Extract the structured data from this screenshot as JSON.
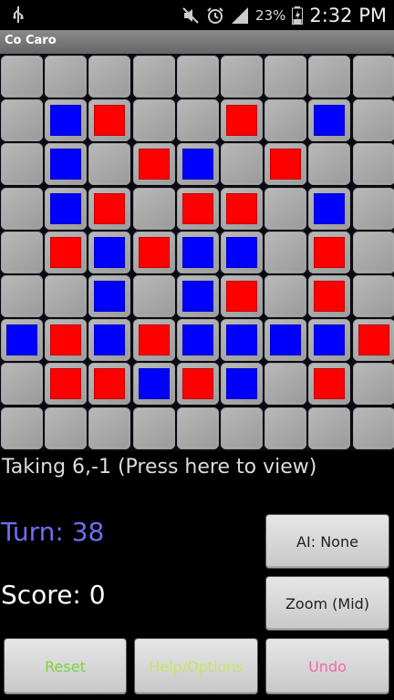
{
  "status_bar": {
    "battery_percent": "23%",
    "time": "2:32 PM",
    "icons": [
      "usb-icon",
      "mute-icon",
      "alarm-icon",
      "signal-icon",
      "battery-icon"
    ]
  },
  "app": {
    "title": "Co Caro"
  },
  "board": {
    "rows": 9,
    "cols": 9,
    "cells": [
      [
        "",
        "",
        "",
        "",
        "",
        "",
        "",
        "",
        ""
      ],
      [
        "",
        "blue",
        "red",
        "",
        "",
        "red",
        "",
        "blue",
        ""
      ],
      [
        "",
        "blue",
        "",
        "red",
        "blue",
        "",
        "red",
        "",
        ""
      ],
      [
        "",
        "blue",
        "red",
        "",
        "red",
        "red",
        "",
        "blue",
        ""
      ],
      [
        "",
        "red",
        "blue",
        "red",
        "blue",
        "blue",
        "",
        "red",
        ""
      ],
      [
        "",
        "",
        "blue",
        "",
        "blue",
        "red",
        "",
        "red",
        ""
      ],
      [
        "blue",
        "red",
        "blue",
        "red",
        "blue",
        "blue",
        "blue",
        "blue",
        "red"
      ],
      [
        "",
        "red",
        "red",
        "blue",
        "red",
        "blue",
        "",
        "red",
        ""
      ],
      [
        "",
        "",
        "",
        "",
        "",
        "",
        "",
        "",
        ""
      ]
    ],
    "colors": {
      "red": "#ff0000",
      "blue": "#0000ff",
      "empty": "#aaaaaa"
    }
  },
  "message": "Taking 6,-1 (Press here to view)",
  "turn_label": "Turn: 38",
  "score_label": "Score: 0",
  "buttons": {
    "ai": "AI: None",
    "zoom": "Zoom (Mid)",
    "reset": "Reset",
    "help": "Help/Options",
    "undo": "Undo"
  }
}
